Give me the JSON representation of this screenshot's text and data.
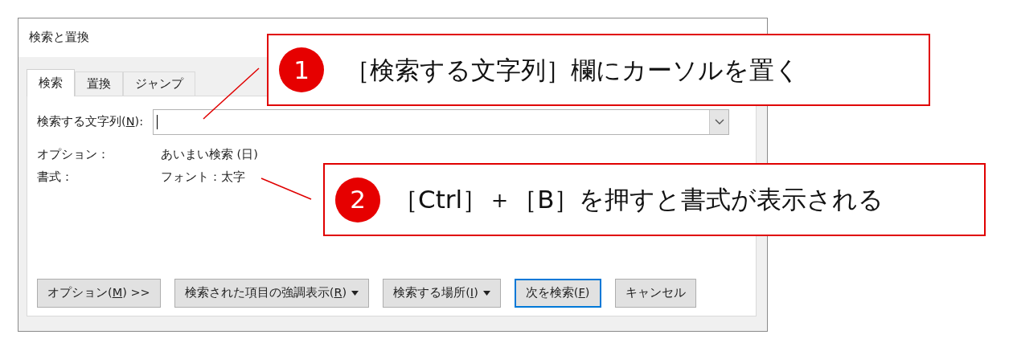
{
  "window": {
    "title": "検索と置換"
  },
  "tabs": [
    {
      "label": "検索",
      "selected": true
    },
    {
      "label": "置換",
      "selected": false
    },
    {
      "label": "ジャンプ",
      "selected": false
    }
  ],
  "find_field": {
    "label_parts": [
      "検索する文字列(",
      "N",
      "):"
    ]
  },
  "info_rows": [
    {
      "label": "オプション：",
      "value": "あいまい検索 (日)"
    },
    {
      "label": "書式：",
      "value": "フォント：太字"
    }
  ],
  "buttons": [
    {
      "label_parts": [
        "オプション(",
        "M",
        ") >>"
      ],
      "dropdown": false,
      "default": false
    },
    {
      "label_parts": [
        "検索された項目の強調表示(",
        "R",
        ")"
      ],
      "dropdown": true,
      "default": false
    },
    {
      "label_parts": [
        "検索する場所(",
        "I",
        ")"
      ],
      "dropdown": true,
      "default": false
    },
    {
      "label_parts": [
        "次を検索(",
        "F",
        ")"
      ],
      "dropdown": false,
      "default": true
    },
    {
      "label_parts": [
        "キャンセル"
      ],
      "dropdown": false,
      "default": false
    }
  ],
  "callouts": [
    {
      "number": "1",
      "text": "［検索する文字列］欄にカーソルを置く"
    },
    {
      "number": "2",
      "text": "［Ctrl］＋［B］を押すと書式が表示される"
    }
  ]
}
